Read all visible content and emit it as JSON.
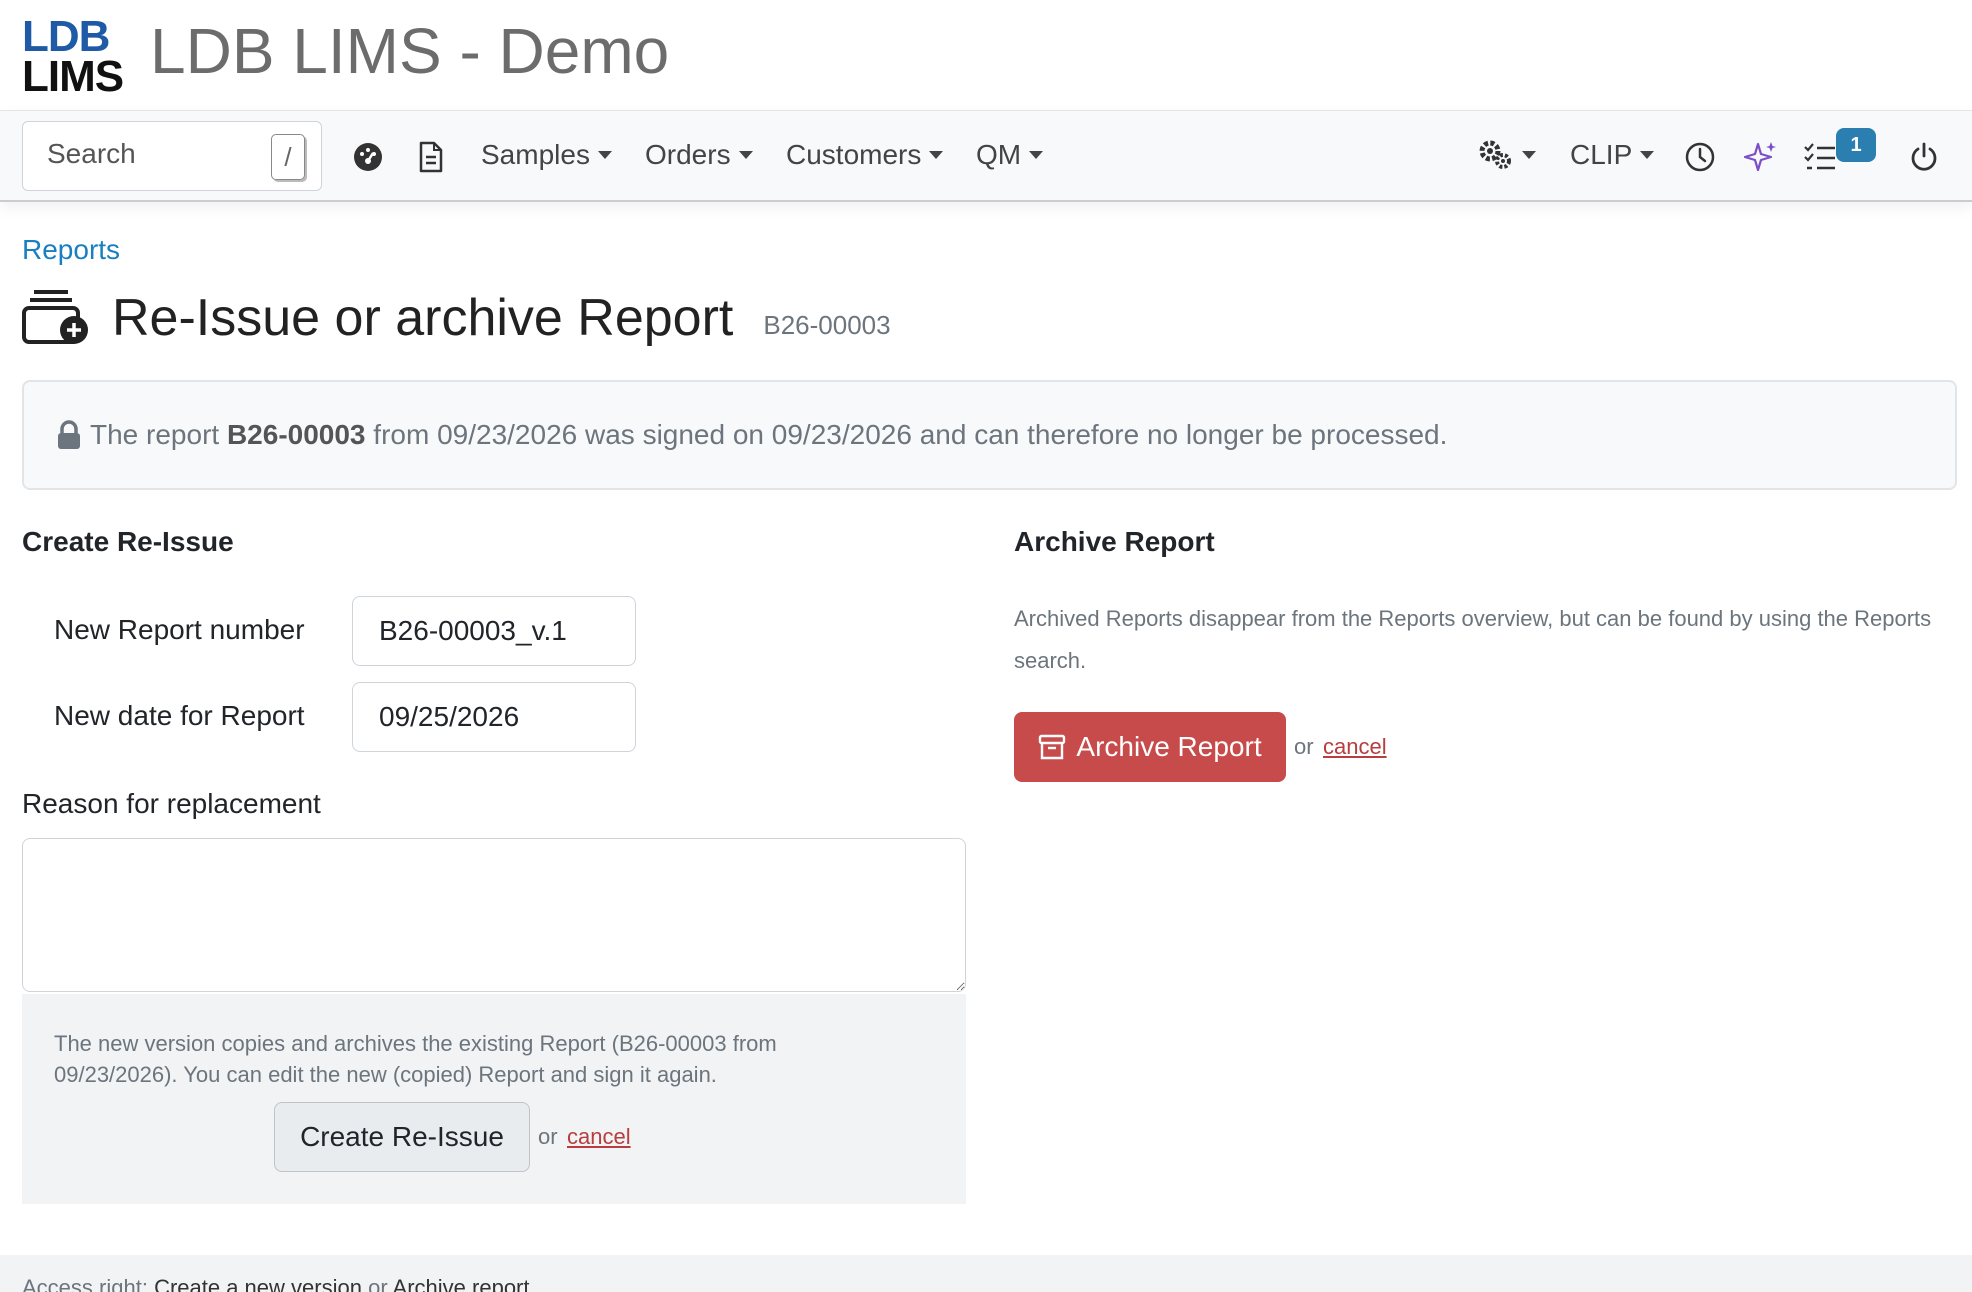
{
  "header": {
    "logo_line1": "LDB",
    "logo_line2": "LIMS",
    "app_title": "LDB LIMS - Demo"
  },
  "navbar": {
    "search_placeholder": "Search",
    "search_shortcut": "/",
    "menus": [
      "Samples",
      "Orders",
      "Customers",
      "QM"
    ],
    "clip_label": "CLIP",
    "tasks_badge": "1",
    "icons": [
      "dashboard-icon",
      "document-icon",
      "settings-gears-icon",
      "history-clock-icon",
      "sparkles-icon",
      "task-list-icon",
      "power-icon"
    ]
  },
  "breadcrumb": "Reports",
  "page": {
    "title": "Re-Issue or archive Report",
    "report_number": "B26-00003"
  },
  "alert": {
    "prefix": "The report",
    "report": "B26-00003",
    "rest": "from 09/23/2026 was signed on 09/23/2026 and can therefore no longer be processed."
  },
  "reissue": {
    "title": "Create Re-Issue",
    "new_number_label": "New Report number",
    "new_number_value": "B26-00003_v.1",
    "new_date_label": "New date for Report",
    "new_date_value": "09/25/2026",
    "reason_label": "Reason for replacement",
    "help": "The new version copies and archives the existing Report (B26-00003 from 09/23/2026). You can edit the new (copied) Report and sign it again.",
    "button": "Create Re-Issue",
    "or": "or",
    "cancel": "cancel"
  },
  "archive": {
    "title": "Archive Report",
    "description": "Archived Reports disappear from the Reports overview, but can be found by using the Reports search.",
    "button": "Archive Report",
    "or": "or",
    "cancel": "cancel"
  },
  "footer": {
    "prefix": "Access right:",
    "right1": "Create a new version",
    "or": "or",
    "right2": "Archive report"
  },
  "colors": {
    "brand_blue": "#1f5aa6",
    "link": "#1a7fc1",
    "danger": "#c84b4b",
    "badge": "#2b7eb0",
    "sparkle": "#7b4fc9"
  }
}
